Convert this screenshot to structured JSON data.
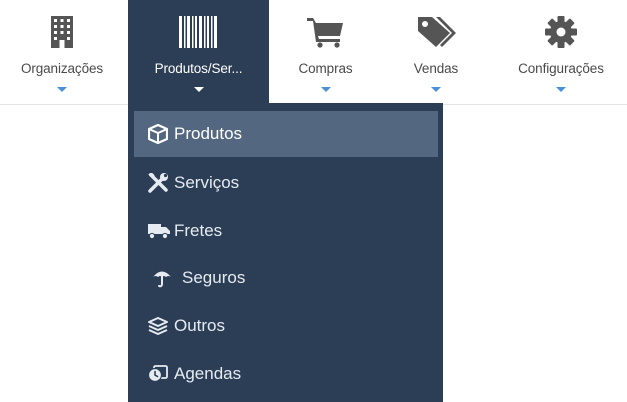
{
  "nav": {
    "items": [
      {
        "label": "Organizações",
        "icon": "building-icon"
      },
      {
        "label": "Produtos/Ser...",
        "icon": "barcode-icon",
        "active": true
      },
      {
        "label": "Compras",
        "icon": "shopping-cart-icon"
      },
      {
        "label": "Vendas",
        "icon": "tags-icon"
      },
      {
        "label": "Configurações",
        "icon": "gear-icon"
      }
    ]
  },
  "dropdown": {
    "items": [
      {
        "label": "Produtos",
        "icon": "cube-icon",
        "active": true
      },
      {
        "label": "Serviços",
        "icon": "wrench-screwdriver-icon"
      },
      {
        "label": "Fretes",
        "icon": "truck-icon"
      },
      {
        "label": "Seguros",
        "icon": "umbrella-icon"
      },
      {
        "label": "Outros",
        "icon": "layers-icon"
      },
      {
        "label": "Agendas",
        "icon": "clock-card-icon"
      }
    ]
  },
  "colors": {
    "menu_bg": "#2c3e55",
    "menu_active_bg": "#546781",
    "caret": "#4a90d9",
    "icon_gray": "#555555"
  }
}
